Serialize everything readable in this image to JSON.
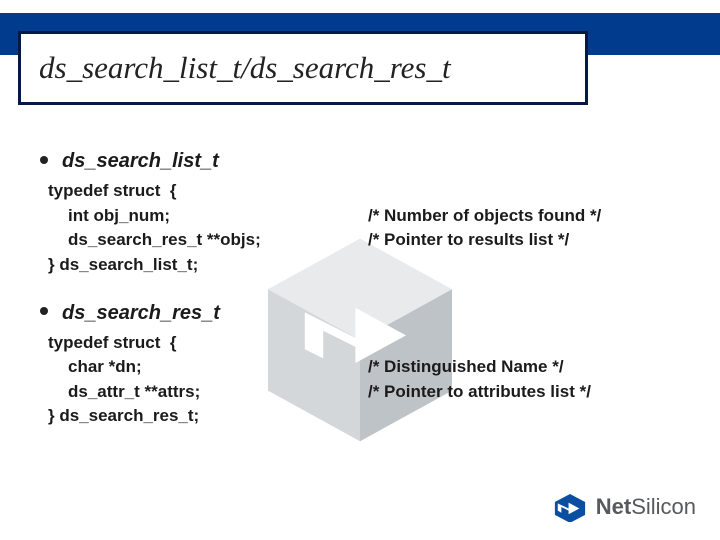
{
  "title": "ds_search_list_t/ds_search_res_t",
  "sections": [
    {
      "heading": "ds_search_list_t",
      "lines": [
        {
          "left": "typedef struct  {",
          "right": "",
          "indent": 1
        },
        {
          "left": "int obj_num;",
          "right": "/* Number of objects found */",
          "indent": 2
        },
        {
          "left": "ds_search_res_t **objs;",
          "right": "/* Pointer to results list */",
          "indent": 2
        },
        {
          "left": "} ds_search_list_t;",
          "right": "",
          "indent": 1
        }
      ]
    },
    {
      "heading": "ds_search_res_t",
      "lines": [
        {
          "left": "typedef struct  {",
          "right": "",
          "indent": 1
        },
        {
          "left": "char *dn;",
          "right": "/* Distinguished Name */",
          "indent": 2
        },
        {
          "left": "ds_attr_t **attrs;",
          "right": "/* Pointer to attributes list */",
          "indent": 2
        },
        {
          "left": "} ds_search_res_t;",
          "right": "",
          "indent": 1
        }
      ]
    }
  ],
  "logo": {
    "brand1": "Net",
    "brand2": "Silicon"
  }
}
